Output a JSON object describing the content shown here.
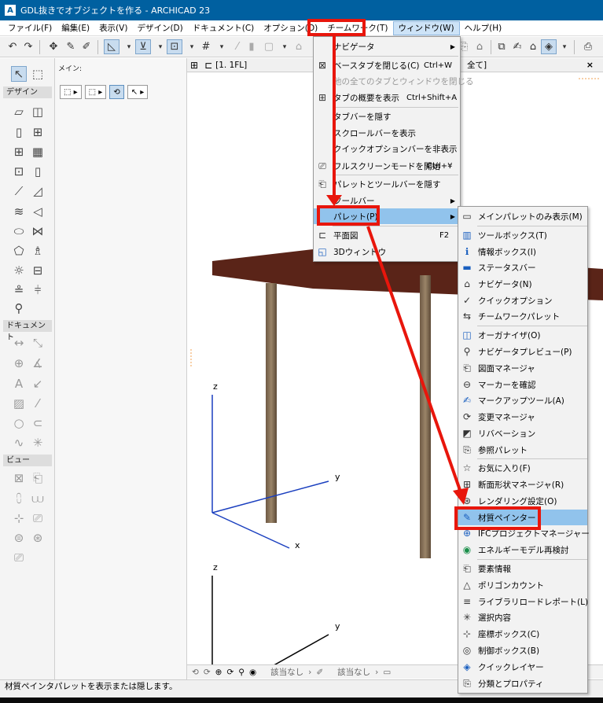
{
  "window": {
    "app_icon": "A",
    "title": "GDL抜きでオブジェクトを作る - ARCHICAD 23"
  },
  "menubar": {
    "items": [
      {
        "label": "ファイル(F)"
      },
      {
        "label": "編集(E)"
      },
      {
        "label": "表示(V)"
      },
      {
        "label": "デザイン(D)"
      },
      {
        "label": "ドキュメント(C)"
      },
      {
        "label": "オプション(O)"
      },
      {
        "label": "チームワーク(T)"
      },
      {
        "label": "ウィンドウ(W)"
      },
      {
        "label": "ヘルプ(H)"
      }
    ],
    "active_index": 7
  },
  "toolbox": {
    "header_label": "メイン:",
    "sections": {
      "design": "デザイン",
      "document": "ドキュメント",
      "view": "ビュー"
    }
  },
  "view": {
    "tab_label": "[1. 1FL]",
    "tab_right_label": "全て]",
    "close_glyph": "×",
    "axes": {
      "z": "z",
      "y": "y",
      "x": "x",
      "z2": "z",
      "y2": "y"
    },
    "bottom_bar": {
      "none1": "該当なし",
      "none2": "該当なし"
    }
  },
  "statusbar": {
    "text": "材質ペインタパレットを表示または隠します。"
  },
  "window_menu": {
    "items": [
      {
        "label": "ナビゲータ",
        "has_arrow": true
      },
      {
        "label": "ベースタブを閉じる(C)",
        "shortcut": "Ctrl+W",
        "icon": "close-tab-icon"
      },
      {
        "label": "他の全てのタブとウィンドウを閉じる",
        "disabled": true
      },
      {
        "label": "タブの概要を表示",
        "shortcut": "Ctrl+Shift+A",
        "icon": "tab-overview-icon"
      },
      {
        "label": "タブバーを隠す"
      },
      {
        "label": "スクロールバーを表示"
      },
      {
        "label": "クイックオプションバーを非表示"
      },
      {
        "label": "フルスクリーンモードを開始",
        "shortcut": "Ctrl+¥",
        "icon": "fullscreen-icon"
      },
      {
        "label": "パレットとツールバーを隠す",
        "icon": "hide-palettes-icon"
      },
      {
        "label": "ツールバー",
        "has_arrow": true
      },
      {
        "label": "パレット(P)",
        "has_arrow": true,
        "highlighted": true
      },
      {
        "label": "平面図",
        "shortcut": "F2",
        "icon": "floor-plan-icon"
      },
      {
        "label": "3Dウィンドウ",
        "icon": "3d-window-icon"
      }
    ]
  },
  "palette_menu": {
    "items": [
      {
        "label": "メインパレットのみ表示(M)",
        "icon": "main-palette-icon"
      },
      {
        "label": "ツールボックス(T)",
        "icon": "toolbox-icon"
      },
      {
        "label": "情報ボックス(I)",
        "icon": "info-box-icon"
      },
      {
        "label": "ステータスバー",
        "icon": "status-bar-icon"
      },
      {
        "label": "ナビゲータ(N)",
        "icon": "navigator-icon"
      },
      {
        "label": "クイックオプション",
        "icon": "quick-options-icon"
      },
      {
        "label": "チームワークパレット",
        "icon": "teamwork-icon"
      },
      {
        "label": "オーガナイザ(O)",
        "icon": "organizer-icon"
      },
      {
        "label": "ナビゲータプレビュー(P)",
        "icon": "navigator-preview-icon"
      },
      {
        "label": "図面マネージャ",
        "icon": "drawing-manager-icon"
      },
      {
        "label": "マーカーを確認",
        "icon": "marker-icon"
      },
      {
        "label": "マークアップツール(A)",
        "icon": "markup-icon"
      },
      {
        "label": "変更マネージャ",
        "icon": "change-manager-icon"
      },
      {
        "label": "リバベーション",
        "icon": "revision-icon"
      },
      {
        "label": "参照パレット",
        "icon": "reference-icon"
      },
      {
        "label": "お気に入り(F)",
        "icon": "favorites-icon"
      },
      {
        "label": "断面形状マネージャ(R)",
        "icon": "profile-manager-icon"
      },
      {
        "label": "レンダリング設定(O)",
        "icon": "rendering-icon"
      },
      {
        "label": "材質ペインター",
        "icon": "material-painter-icon",
        "highlighted": true
      },
      {
        "label": "IFCプロジェクトマネージャー",
        "icon": "ifc-icon"
      },
      {
        "label": "エネルギーモデル再検討",
        "icon": "energy-icon"
      },
      {
        "label": "要素情報",
        "icon": "element-info-icon"
      },
      {
        "label": "ポリゴンカウント",
        "icon": "polygon-count-icon"
      },
      {
        "label": "ライブラリロードレポート(L)",
        "icon": "library-report-icon"
      },
      {
        "label": "選択内容",
        "icon": "selection-icon"
      },
      {
        "label": "座標ボックス(C)",
        "icon": "coordinate-box-icon"
      },
      {
        "label": "制御ボックス(B)",
        "icon": "control-box-icon"
      },
      {
        "label": "クイックレイヤー",
        "icon": "quick-layer-icon"
      },
      {
        "label": "分類とプロパティ",
        "icon": "classification-icon"
      }
    ]
  },
  "colors": {
    "titlebar": "#0060a0",
    "highlight": "#91c3ec",
    "annotation_red": "#e8160c",
    "slab": "#5a2418",
    "column": "#8b7355"
  }
}
